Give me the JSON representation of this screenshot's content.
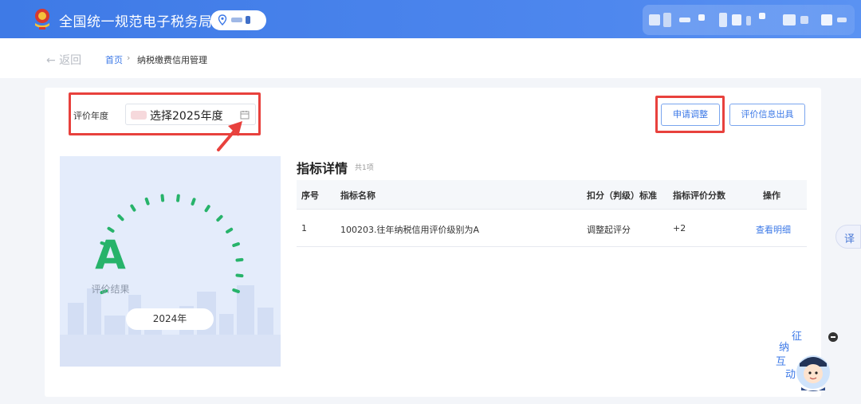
{
  "header": {
    "site_title": "全国统一规范电子税务局",
    "brand_color": "#4a84ec"
  },
  "breadcrumb": {
    "back_label": "← 返回",
    "home_label": "首页",
    "separator": "›",
    "current_label": "纳税缴费信用管理"
  },
  "filter": {
    "year_label": "评价年度",
    "year_value": "选择2025年度"
  },
  "actions": {
    "apply_adjust_label": "申请调整",
    "issue_report_label": "评价信息出具"
  },
  "result": {
    "grade": "A",
    "grade_caption": "评价结果",
    "year": "2024年",
    "grade_color": "#27b36a"
  },
  "detail": {
    "title": "指标详情",
    "count_text": "共1项",
    "columns": [
      "序号",
      "指标名称",
      "扣分（判级）标准",
      "指标评价分数",
      "操作"
    ],
    "rows": [
      {
        "no": "1",
        "name": "100203.往年纳税信用评价级别为A",
        "standard": "调整起评分",
        "score": "+2",
        "action": "查看明细"
      }
    ]
  },
  "widgets": {
    "translate_label": "译",
    "assistant_label_1": "征",
    "assistant_label_2": "纳",
    "assistant_label_3": "互",
    "assistant_label_4": "动"
  },
  "highlight_color": "#e8413d",
  "accent_color": "#3b78e7"
}
